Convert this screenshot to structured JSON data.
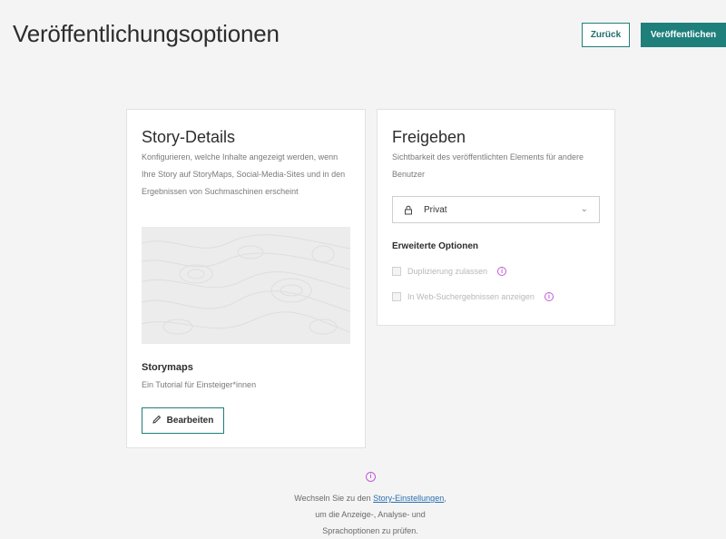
{
  "header": {
    "title": "Veröffentlichungsoptionen",
    "back_label": "Zurück",
    "publish_label": "Veröffentlichen"
  },
  "story_details": {
    "title": "Story-Details",
    "description": "Konfigurieren, welche Inhalte angezeigt werden, wenn Ihre Story auf StoryMaps, Social-Media-Sites und in den Ergebnissen von Suchmaschinen erscheint",
    "story_title": "Storymaps",
    "story_subtitle": "Ein Tutorial für Einsteiger*innen",
    "edit_label": "Bearbeiten"
  },
  "share": {
    "title": "Freigeben",
    "description": "Sichtbarkeit des veröffentlichten Elements für andere Benutzer",
    "visibility_value": "Privat",
    "advanced_title": "Erweiterte Optionen",
    "options": [
      {
        "label": "Duplizierung zulassen",
        "checked": false,
        "disabled": true
      },
      {
        "label": "In Web-Suchergebnissen anzeigen",
        "checked": false,
        "disabled": true
      }
    ]
  },
  "footer": {
    "text_before": "Wechseln Sie zu den ",
    "link": "Story-Einstellungen",
    "text_after": ",",
    "line2": "um die Anzeige-, Analyse- und",
    "line3": "Sprachoptionen zu prüfen."
  },
  "colors": {
    "accent": "#1e7f7b",
    "info": "#c15bd6",
    "link": "#2a6fb0"
  }
}
